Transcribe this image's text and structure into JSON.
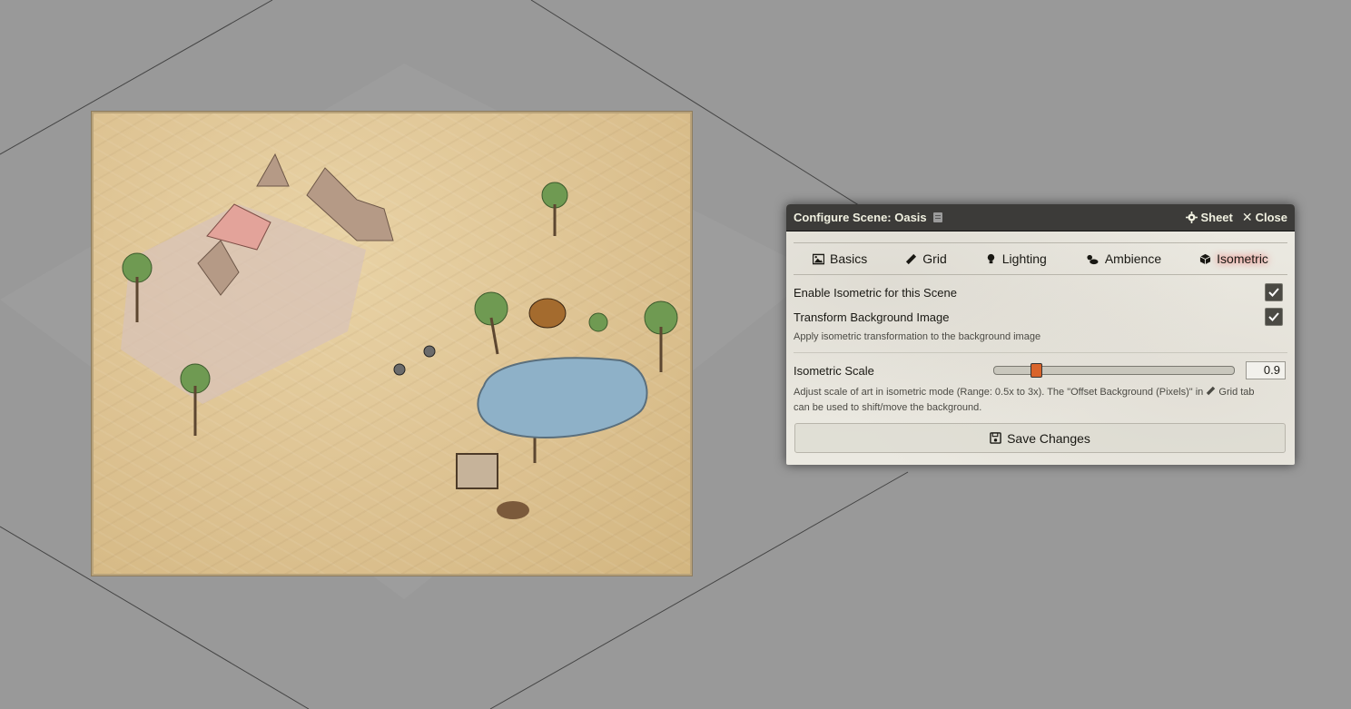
{
  "dialog": {
    "title": "Configure Scene: Oasis",
    "sheet_label": "Sheet",
    "close_label": "Close",
    "tabs": [
      {
        "label": "Basics",
        "icon": "image-icon"
      },
      {
        "label": "Grid",
        "icon": "ruler-icon"
      },
      {
        "label": "Lighting",
        "icon": "lightbulb-icon"
      },
      {
        "label": "Ambience",
        "icon": "cloud-sun-icon"
      },
      {
        "label": "Isometric",
        "icon": "cube-icon",
        "active": true
      }
    ],
    "enable_label": "Enable Isometric for this Scene",
    "enable_checked": true,
    "transform_label": "Transform Background Image",
    "transform_checked": true,
    "transform_hint": "Apply isometric transformation to the background image",
    "scale_label": "Isometric Scale",
    "scale_value": "0.9",
    "scale_range": {
      "min": 0.5,
      "max": 3,
      "value": 0.9
    },
    "scale_hint_1": "Adjust scale of art in isometric mode (Range: 0.5x to 3x). The \"Offset Background (Pixels)\" in",
    "scale_hint_grid": "Grid tab",
    "scale_hint_2": "can be used to shift/move the background.",
    "save_label": "Save Changes"
  },
  "colors": {
    "canvas": "#999999",
    "header": "#3c3b39",
    "accent": "#d9642b",
    "active_glow": "#ff4040"
  }
}
